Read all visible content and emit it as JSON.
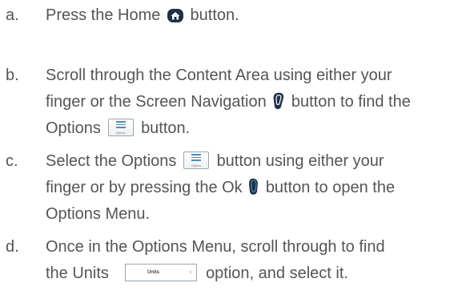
{
  "steps": [
    {
      "letter": "a.",
      "lines": [
        [
          "Press the Home",
          "button."
        ]
      ]
    },
    {
      "letter": "b.",
      "lines": [
        [
          "Scroll through the Content Area using either your"
        ],
        [
          "finger or the Screen Navigation",
          "button to find the"
        ],
        [
          "Options",
          "button."
        ]
      ]
    },
    {
      "letter": "c.",
      "lines": [
        [
          "Select the Options",
          "button using either your"
        ],
        [
          "finger or by pressing the Ok",
          "button to open the"
        ],
        [
          "Options Menu."
        ]
      ]
    },
    {
      "letter": "d.",
      "lines": [
        [
          "Once in the Options Menu, scroll through to find"
        ],
        [
          "the Units",
          "option, and select it."
        ]
      ]
    }
  ],
  "icons": {
    "options_caption": "Options",
    "units_caption": "Units",
    "chevron_glyph": "›"
  },
  "colors": {
    "text": "#555555",
    "icon_dark": "#1f3147",
    "icon_accent": "#4d8fb8"
  }
}
